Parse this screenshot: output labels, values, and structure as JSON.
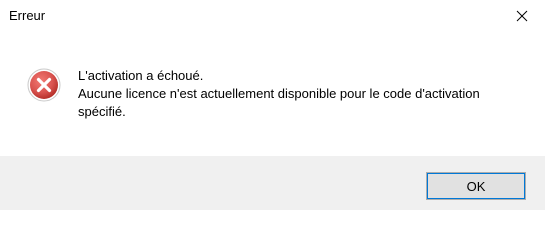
{
  "window": {
    "title": "Erreur",
    "close_icon": "close-icon"
  },
  "message": {
    "icon": "error-icon",
    "line1": "L'activation a échoué.",
    "line2": "Aucune licence n'est actuellement disponible pour le code d'activation spécifié."
  },
  "buttons": {
    "ok_label": "OK"
  },
  "colors": {
    "error_red": "#d9534f",
    "footer_bg": "#f0f0f0",
    "button_bg": "#e1e1e1",
    "focus_blue": "#0078d7"
  }
}
